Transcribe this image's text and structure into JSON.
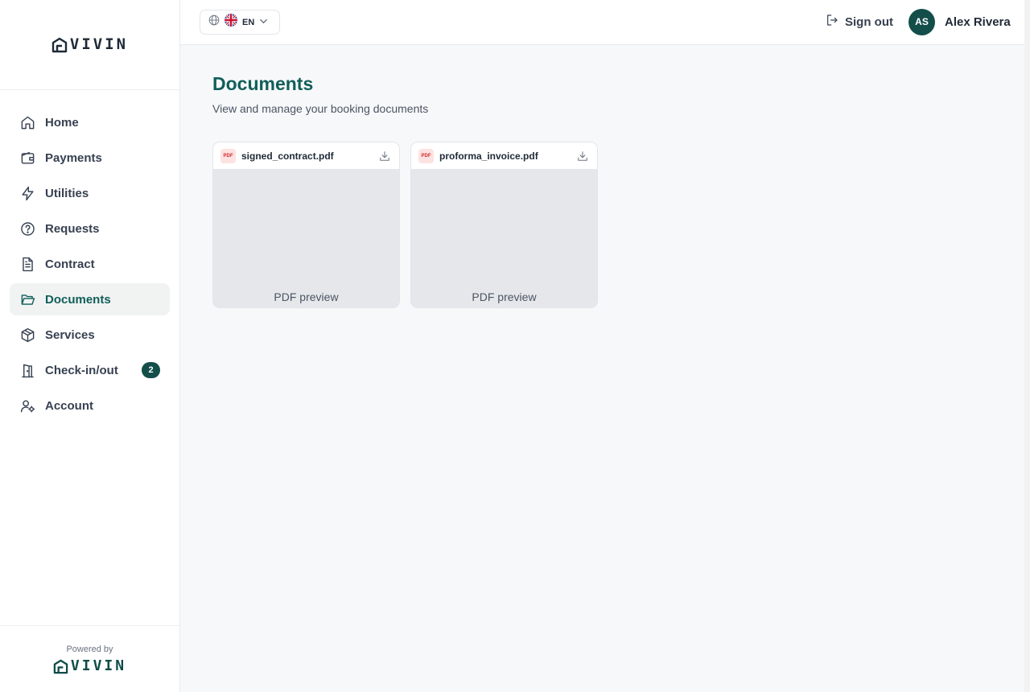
{
  "brand": {
    "logo_text": "VIVIN"
  },
  "sidebar": {
    "items": [
      {
        "label": "Home",
        "icon": "home-icon"
      },
      {
        "label": "Payments",
        "icon": "wallet-icon"
      },
      {
        "label": "Utilities",
        "icon": "bolt-icon"
      },
      {
        "label": "Requests",
        "icon": "help-circle-icon"
      },
      {
        "label": "Contract",
        "icon": "file-text-icon"
      },
      {
        "label": "Documents",
        "icon": "folder-open-icon",
        "active": true
      },
      {
        "label": "Services",
        "icon": "box-icon"
      },
      {
        "label": "Check-in/out",
        "icon": "door-icon",
        "badge": "2"
      },
      {
        "label": "Account",
        "icon": "user-cog-icon"
      }
    ],
    "footer": {
      "powered_by": "Powered by",
      "logo_text": "VIVIN"
    }
  },
  "header": {
    "language": {
      "code": "EN",
      "icon": "globe-icon",
      "flag": "uk-flag-icon"
    },
    "sign_out_label": "Sign out",
    "user": {
      "initials": "AS",
      "name": "Alex Rivera"
    }
  },
  "main": {
    "title": "Documents",
    "subtitle": "View and manage your booking documents",
    "documents": [
      {
        "type_tag": "PDF",
        "filename": "signed_contract.pdf",
        "preview_label": "PDF preview"
      },
      {
        "type_tag": "PDF",
        "filename": "proforma_invoice.pdf",
        "preview_label": "PDF preview"
      }
    ]
  },
  "colors": {
    "brand_teal": "#115e59",
    "active_bg": "#f0f3f2",
    "avatar_bg": "#134e4a",
    "page_bg": "#f7f8fa",
    "pdf_tag_bg": "#fde2e2",
    "pdf_tag_text": "#d12b2b"
  }
}
